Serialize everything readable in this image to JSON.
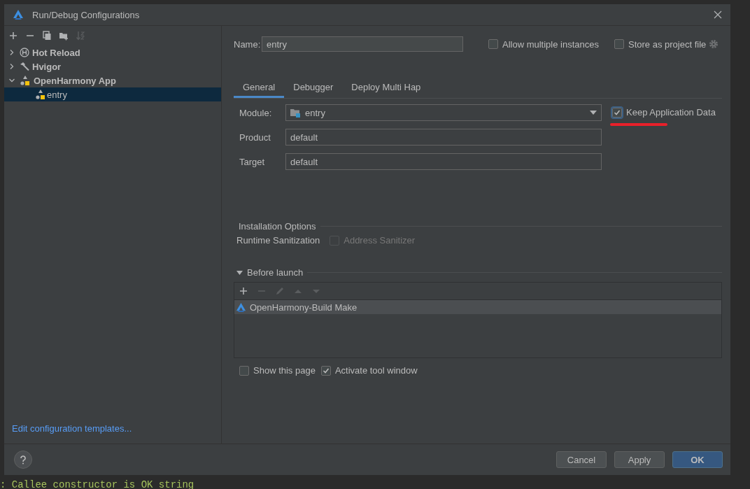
{
  "window": {
    "title": "Run/Debug Configurations"
  },
  "sidebar": {
    "toolbar": [
      {
        "kind": "add",
        "disabled": false
      },
      {
        "kind": "remove",
        "disabled": false
      },
      {
        "kind": "copy",
        "disabled": false
      },
      {
        "kind": "folder",
        "disabled": false
      },
      {
        "kind": "sort",
        "disabled": true
      }
    ],
    "tree": [
      {
        "label": "Hot Reload",
        "kind": "reload",
        "expanded": false,
        "selected": false
      },
      {
        "label": "Hvigor",
        "kind": "hammer",
        "expanded": false,
        "selected": false
      },
      {
        "label": "OpenHarmony App",
        "kind": "app",
        "expanded": true,
        "selected": false,
        "children": [
          {
            "label": "entry",
            "kind": "app",
            "selected": true
          }
        ]
      }
    ],
    "link": "Edit configuration templates..."
  },
  "name_field": {
    "label": "Name:",
    "value": "entry"
  },
  "top_options": [
    {
      "label": "Allow multiple instances",
      "checked": false
    },
    {
      "label": "Store as project file",
      "checked": false
    }
  ],
  "tabs": [
    {
      "label": "General",
      "selected": true
    },
    {
      "label": "Debugger",
      "selected": false
    },
    {
      "label": "Deploy Multi Hap",
      "selected": false
    }
  ],
  "fields": [
    {
      "kind": "dropdown",
      "label": "Module:",
      "value": "entry"
    },
    {
      "kind": "text",
      "label": "Product",
      "value": "default"
    },
    {
      "kind": "text",
      "label": "Target",
      "value": "default"
    }
  ],
  "keep_data": {
    "label": "Keep Application Data",
    "checked": true
  },
  "installation_options": {
    "title": "Installation Options",
    "runtime_label": "Runtime Sanitization",
    "sanitizer": {
      "label": "Address Sanitizer",
      "checked": false,
      "disabled": true
    }
  },
  "before_launch": {
    "title": "Before launch",
    "expanded": true,
    "toolbar": [
      {
        "kind": "add",
        "disabled": false
      },
      {
        "kind": "remove",
        "disabled": true
      },
      {
        "kind": "edit",
        "disabled": true
      },
      {
        "kind": "up",
        "disabled": true
      },
      {
        "kind": "down",
        "disabled": true
      }
    ],
    "tasks": [
      {
        "label": "OpenHarmony-Build Make",
        "selected": true
      }
    ]
  },
  "bottom_options": [
    {
      "label": "Show this page",
      "checked": false
    },
    {
      "label": "Activate tool window",
      "checked": true
    }
  ],
  "buttons": [
    {
      "label": "Cancel",
      "kind": "normal"
    },
    {
      "label": "Apply",
      "kind": "normal"
    },
    {
      "label": "OK",
      "kind": "default"
    }
  ],
  "console": {
    "line": ": Callee constructor is OK string"
  }
}
